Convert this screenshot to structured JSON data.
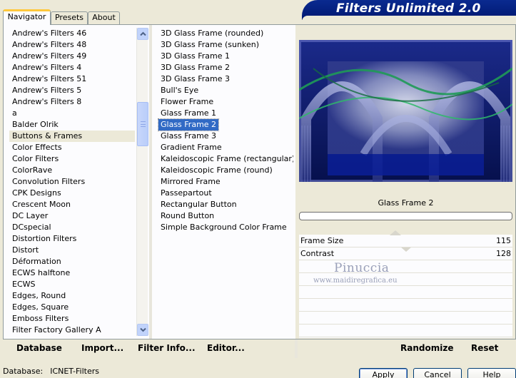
{
  "app_title": "Filters Unlimited 2.0",
  "tabs": [
    {
      "label": "Navigator",
      "active": true
    },
    {
      "label": "Presets",
      "active": false
    },
    {
      "label": "About",
      "active": false
    }
  ],
  "categories": [
    "Andrew's Filters 46",
    "Andrew's Filters 48",
    "Andrew's Filters 49",
    "Andrew's Filters 4",
    "Andrew's Filters 51",
    "Andrew's Filters 5",
    "Andrew's Filters 8",
    "a",
    "Balder Olrik",
    "Buttons & Frames",
    "Color Effects",
    "Color Filters",
    "ColorRave",
    "Convolution Filters",
    "CPK Designs",
    "Crescent Moon",
    "DC Layer",
    "DCspecial",
    "Distortion Filters",
    "Distort",
    "Déformation",
    "ECWS halftone",
    "ECWS",
    "Edges, Round",
    "Edges, Square",
    "Emboss Filters",
    "Filter Factory Gallery A"
  ],
  "selected_category": "Buttons & Frames",
  "filters": [
    {
      "label": "3D Glass Frame (rounded)",
      "group": false
    },
    {
      "label": "3D Glass Frame (sunken)",
      "group": false
    },
    {
      "label": "3D Glass Frame 1",
      "group": false
    },
    {
      "label": "3D Glass Frame 2",
      "group": false
    },
    {
      "label": "3D Glass Frame 3",
      "group": false
    },
    {
      "label": "Bull's Eye",
      "group": false
    },
    {
      "label": "Flower Frame",
      "group": true
    },
    {
      "label": "Glass Frame 1",
      "group": false
    },
    {
      "label": "Glass Frame 2",
      "group": false
    },
    {
      "label": "Glass Frame 3",
      "group": false
    },
    {
      "label": "Gradient Frame",
      "group": true
    },
    {
      "label": "Kaleidoscopic Frame (rectangular)",
      "group": false
    },
    {
      "label": "Kaleidoscopic Frame (round)",
      "group": false
    },
    {
      "label": "Mirrored Frame",
      "group": false
    },
    {
      "label": "Passepartout",
      "group": true
    },
    {
      "label": "Rectangular Button",
      "group": false
    },
    {
      "label": "Round Button",
      "group": false
    },
    {
      "label": "Simple Background Color Frame",
      "group": false
    }
  ],
  "selected_filter": "Glass Frame 2",
  "preview": {
    "filter_name": "Glass Frame 2"
  },
  "parameters": [
    {
      "label": "Frame Size",
      "value": "115",
      "slider_fraction": 0.451
    },
    {
      "label": "Contrast",
      "value": "128",
      "slider_fraction": 0.502
    }
  ],
  "watermark": {
    "name": "Pinuccia",
    "url": "www.maidiregrafica.eu"
  },
  "bottom_bar": {
    "database": "Database",
    "import": "Import...",
    "filter_info": "Filter Info...",
    "editor": "Editor...",
    "randomize": "Randomize",
    "reset": "Reset"
  },
  "status": {
    "label": "Database:",
    "value": "ICNET-Filters"
  },
  "dialog_buttons": {
    "apply": "Apply",
    "cancel": "Cancel",
    "help": "Help"
  },
  "colors": {
    "banner": "#0a2a90",
    "selection": "#316ac5",
    "window_bg": "#ece9d8",
    "tab_highlight": "#ffc83c"
  }
}
